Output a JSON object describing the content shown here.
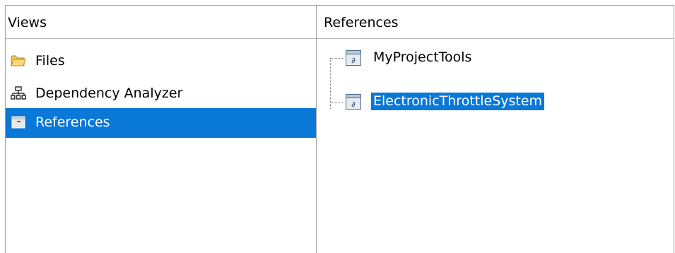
{
  "views_panel": {
    "header": "Views",
    "items": [
      {
        "label": "Files",
        "icon": "folder-icon",
        "selected": false
      },
      {
        "label": "Dependency Analyzer",
        "icon": "dependency-tree-icon",
        "selected": false
      },
      {
        "label": "References",
        "icon": "references-icon",
        "selected": true
      }
    ]
  },
  "references_panel": {
    "header": "References",
    "nodes": [
      {
        "label": "MyProjectTools",
        "icon": "project-reference-icon",
        "selected": false
      },
      {
        "label": "ElectronicThrottleSystem",
        "icon": "project-reference-icon",
        "selected": true
      }
    ]
  },
  "colors": {
    "selection": "#0a78d7",
    "border": "#a0a0a0"
  }
}
